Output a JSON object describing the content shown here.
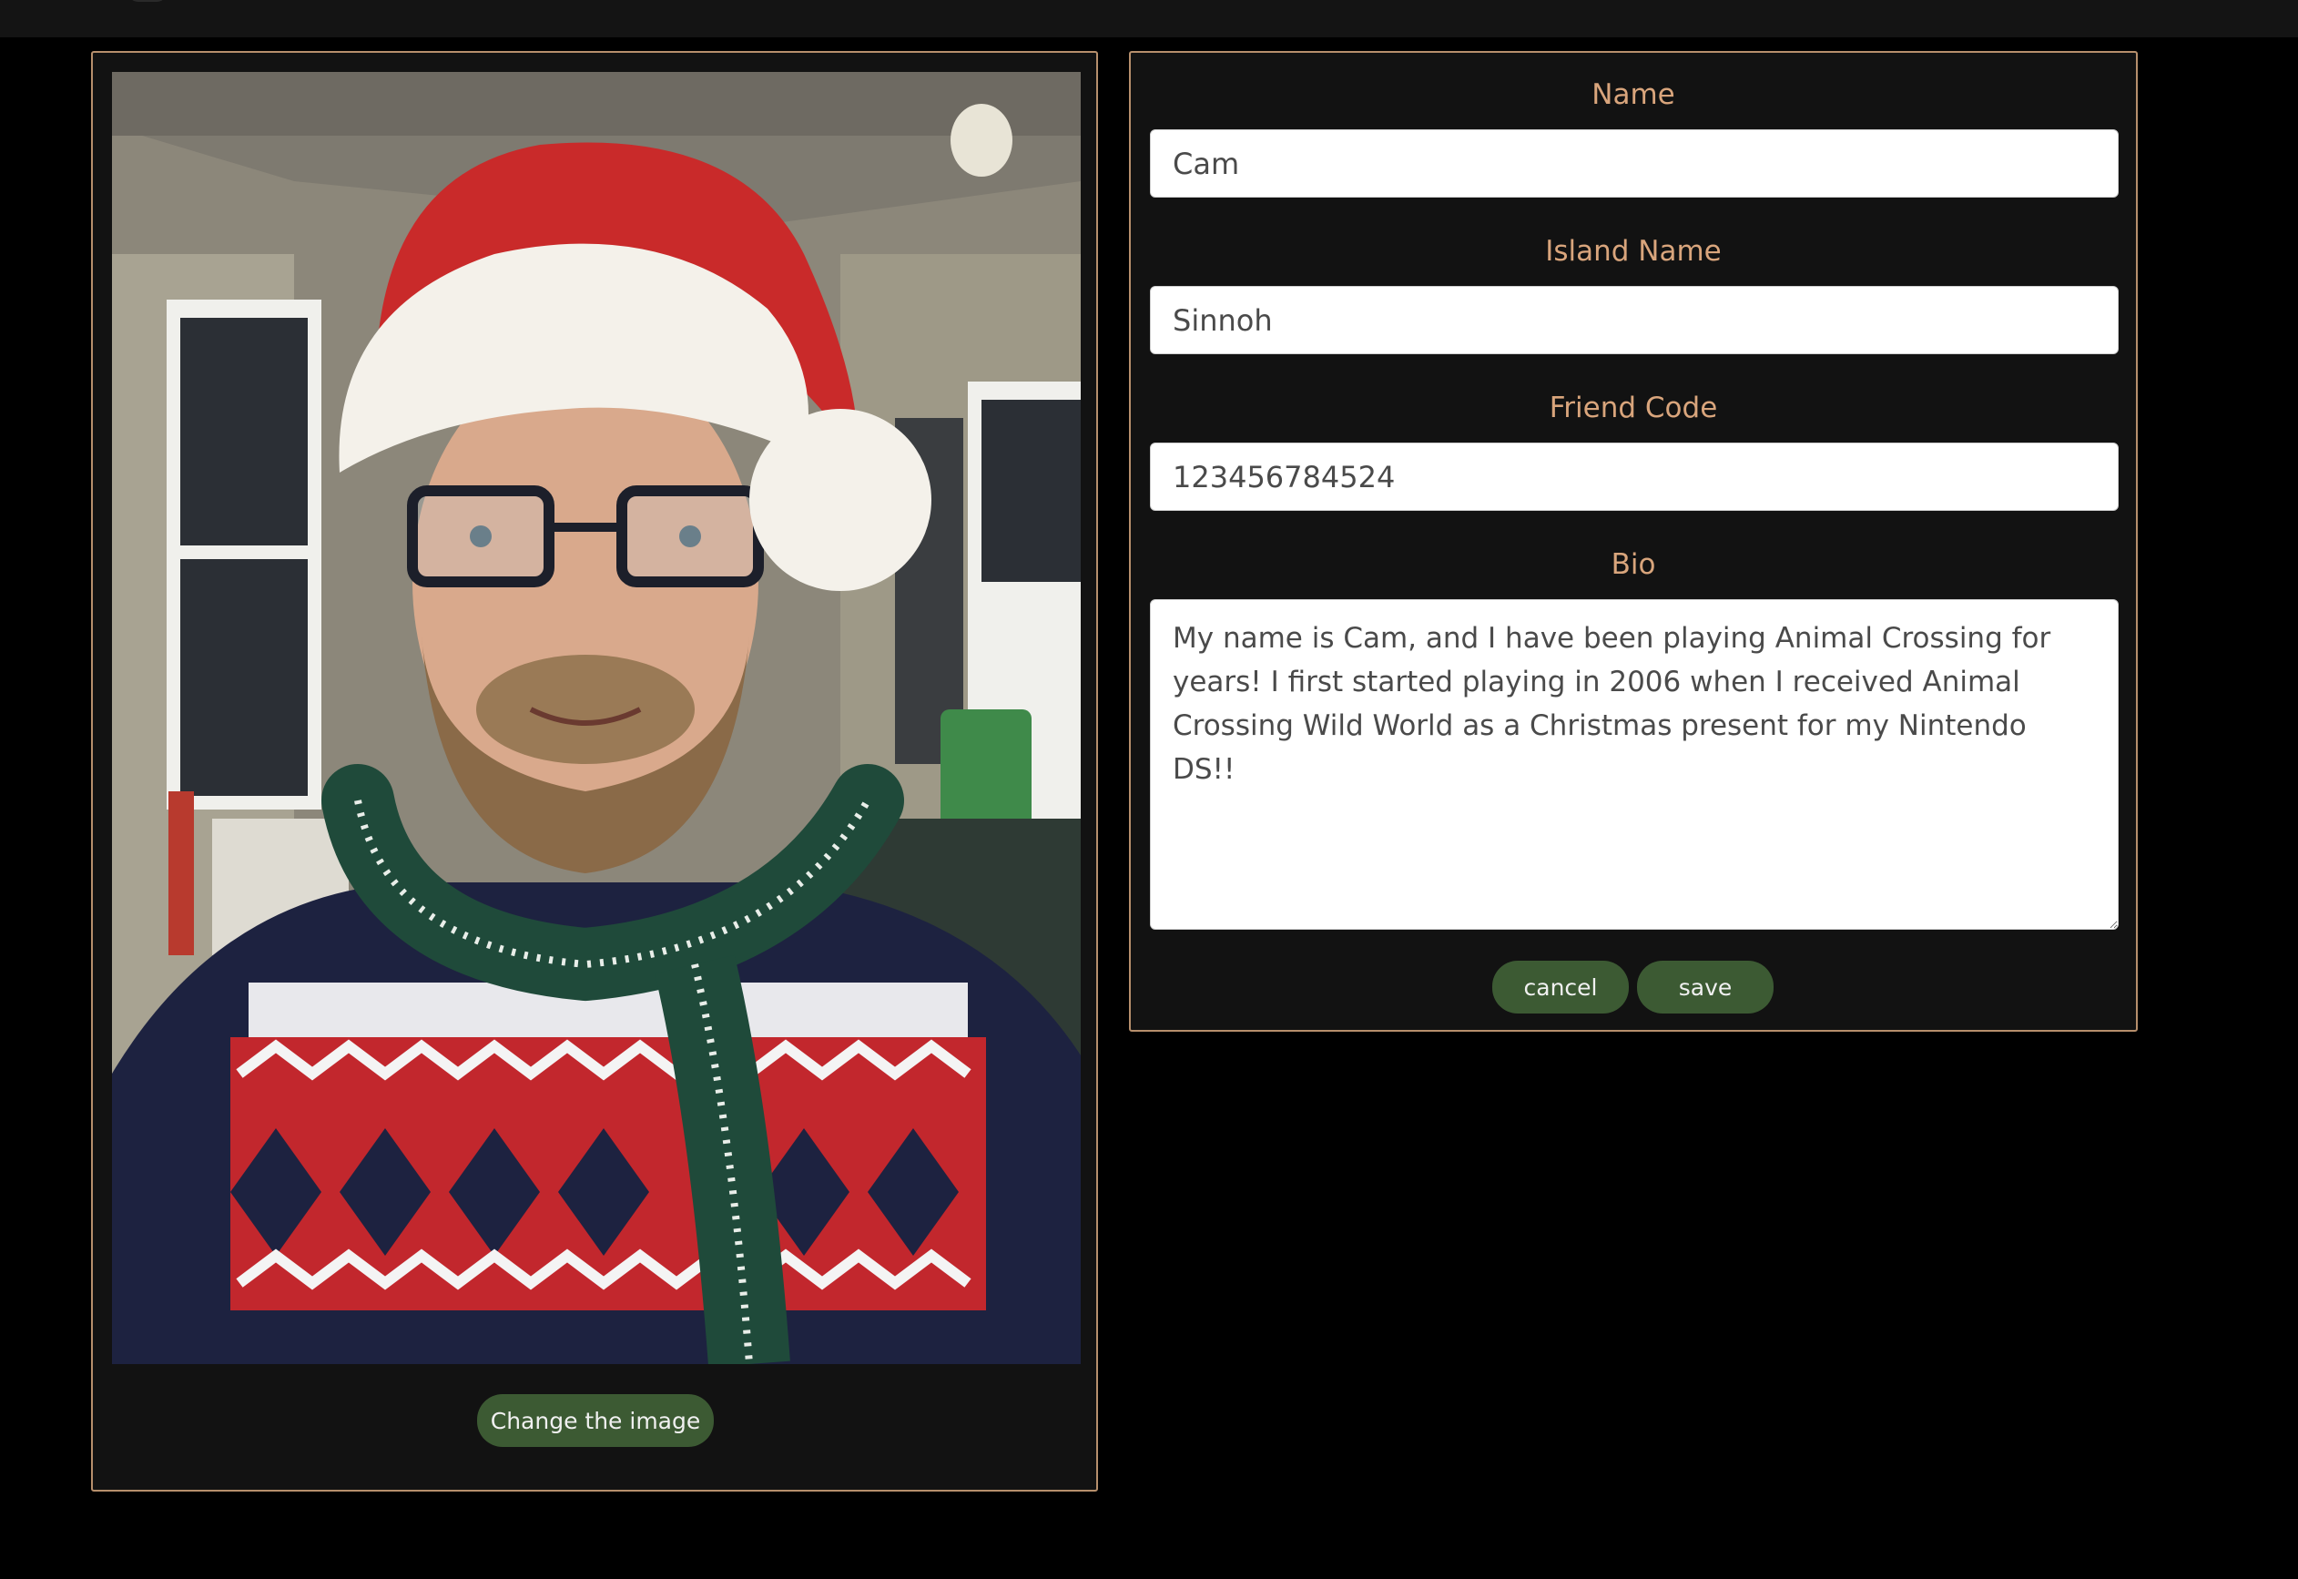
{
  "profile_image": {
    "change_button_label": "Change the image"
  },
  "form": {
    "name_label": "Name",
    "name_value": "Cam",
    "island_label": "Island Name",
    "island_value": "Sinnoh",
    "friend_code_label": "Friend Code",
    "friend_code_value": "123456784524",
    "bio_label": "Bio",
    "bio_value": "My name is Cam, and I have been playing Animal Crossing for years! I first started playing in 2006 when I received Animal Crossing Wild World as a Christmas present for my Nintendo DS!!",
    "cancel_label": "cancel",
    "save_label": "save"
  },
  "colors": {
    "card_border": "#b68f6c",
    "label_text": "#d9a57c",
    "button_bg": "#3c5a33",
    "card_bg": "#121212",
    "page_bg": "#000000"
  }
}
